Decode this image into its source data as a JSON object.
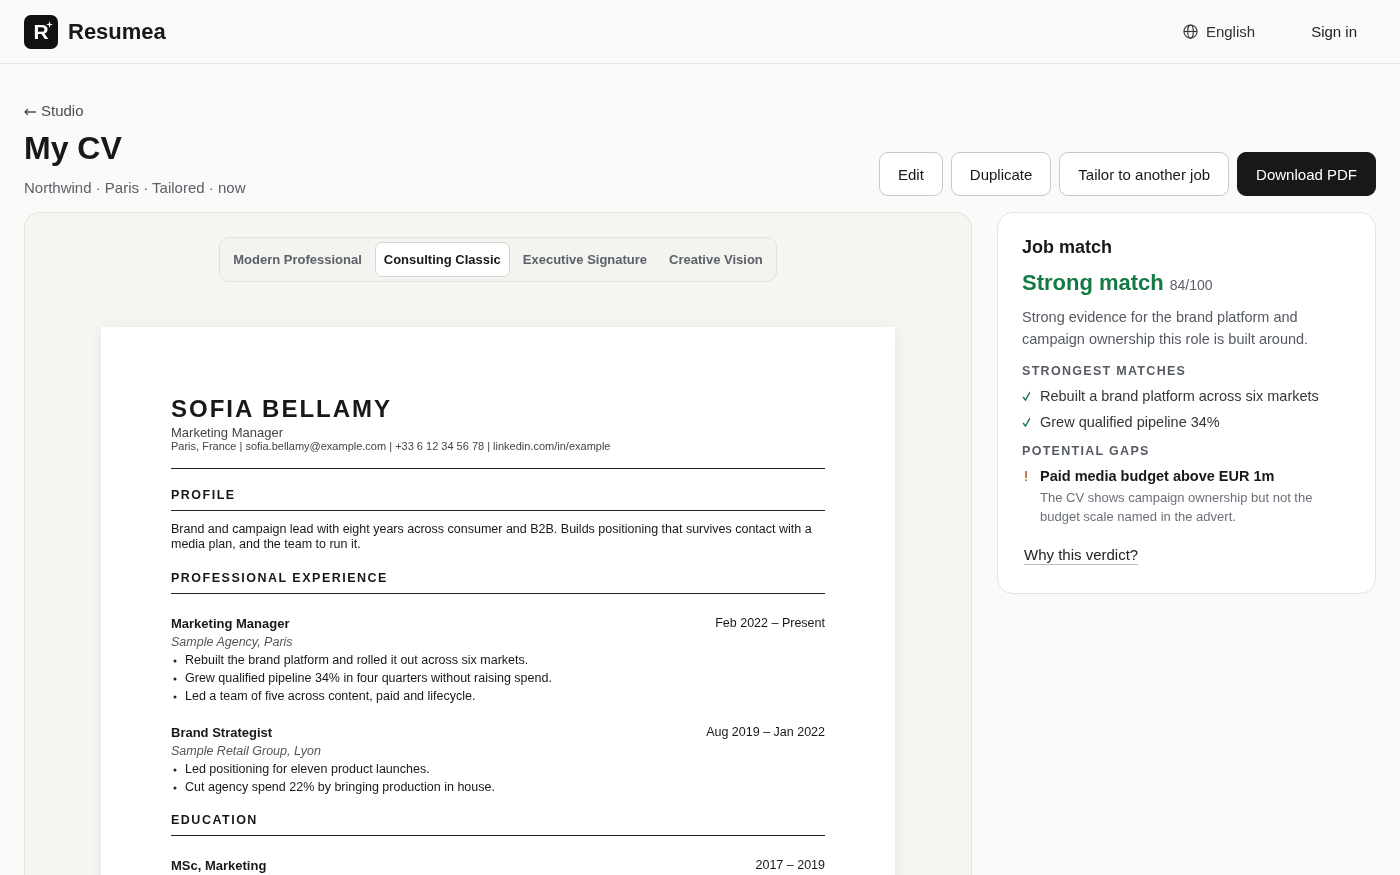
{
  "header": {
    "logo_mark": "R",
    "brand": "Resumea",
    "language": "English",
    "sign_in": "Sign in"
  },
  "page": {
    "back_link": "Studio",
    "title": "My CV",
    "subtitle": "Northwind · Paris · Tailored · now",
    "actions": [
      {
        "label": "Edit",
        "kind": "secondary"
      },
      {
        "label": "Duplicate",
        "kind": "secondary"
      },
      {
        "label": "Tailor to another job",
        "kind": "secondary"
      },
      {
        "label": "Download PDF",
        "kind": "primary"
      }
    ]
  },
  "templates": [
    {
      "label": "Modern Professional",
      "selected": false
    },
    {
      "label": "Consulting Classic",
      "selected": true
    },
    {
      "label": "Executive Signature",
      "selected": false
    },
    {
      "label": "Creative Vision",
      "selected": false
    }
  ],
  "resume": {
    "name": "SOFIA BELLAMY",
    "role": "Marketing Manager",
    "contact": "Paris, France | sofia.bellamy@example.com | +33 6 12 34 56 78 | linkedin.com/in/example",
    "sections": [
      {
        "heading": "PROFILE",
        "kind": "text",
        "text": "Brand and campaign lead with eight years across consumer and B2B. Builds positioning that survives contact with a media plan, and the team to run it."
      },
      {
        "heading": "PROFESSIONAL EXPERIENCE",
        "kind": "entries",
        "entries": [
          {
            "title": "Marketing Manager",
            "dates": "Feb 2022 – Present",
            "org": "Sample Agency, Paris",
            "bullets": [
              "Rebuilt the brand platform and rolled it out across six markets.",
              "Grew qualified pipeline 34% in four quarters without raising spend.",
              "Led a team of five across content, paid and lifecycle."
            ]
          },
          {
            "title": "Brand Strategist",
            "dates": "Aug 2019 – Jan 2022",
            "org": "Sample Retail Group, Lyon",
            "bullets": [
              "Led positioning for eleven product launches.",
              "Cut agency spend 22% by bringing production in house."
            ]
          }
        ]
      },
      {
        "heading": "EDUCATION",
        "kind": "entries",
        "entries": [
          {
            "title": "MSc, Marketing",
            "dates": "2017 – 2019"
          }
        ]
      }
    ]
  },
  "job_match": {
    "title": "Job match",
    "verdict": "Strong match",
    "score": "84/100",
    "summary": "Strong evidence for the brand platform and campaign ownership this role is built around.",
    "groups": [
      {
        "heading": "STRONGEST MATCHES",
        "kind": "match",
        "items": [
          {
            "text": "Rebuilt a brand platform across six markets"
          },
          {
            "text": "Grew qualified pipeline 34%"
          }
        ]
      },
      {
        "heading": "POTENTIAL GAPS",
        "kind": "gap",
        "items": [
          {
            "text": "Paid media budget above EUR 1m",
            "detail": "The CV shows campaign ownership but not the budget scale named in the advert."
          }
        ]
      }
    ],
    "link": "Why this verdict?"
  }
}
